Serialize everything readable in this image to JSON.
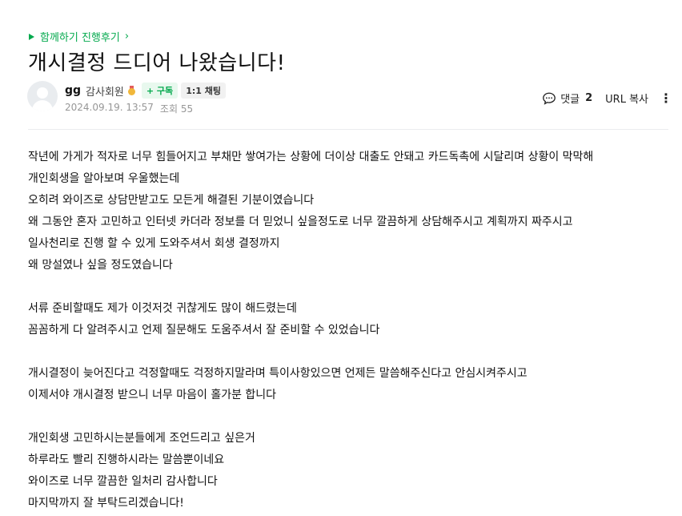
{
  "board": {
    "name": "함께하기 진행후기",
    "chevron": "›"
  },
  "post": {
    "title": "개시결정 드디어 나왔습니다!",
    "author": {
      "nickname": "gg",
      "grade": "감사회원",
      "subscribe_label": "+ 구독",
      "chat_label": "1:1 채팅"
    },
    "date": "2024.09.19. 13:57",
    "views": "조회 55"
  },
  "tools": {
    "comment_label": "댓글",
    "comment_count": "2",
    "url_copy_label": "URL 복사",
    "more_label": "⋮"
  },
  "body": {
    "lines": [
      "작년에 가게가 적자로 너무 힘들어지고 부채만 쌓여가는 상황에 더이상 대출도 안돼고 카드독촉에 시달리며 상황이 막막해",
      "개인회생을 알아보며 우울했는데",
      "오히려 와이즈로 상담만받고도 모든게 해결된 기분이였습니다",
      "왜 그동안 혼자 고민하고 인터넷 카더라 정보를 더 믿었니 싶을정도로 너무 깔끔하게 상담해주시고 계획까지 짜주시고",
      "일사천리로 진행 할 수 있게 도와주셔서 회생 결정까지",
      "왜 망설였나 싶을 정도였습니다",
      "",
      "서류 준비할때도 제가 이것저것 귀찮게도 많이 해드렸는데",
      "꼼꼼하게 다 알려주시고 언제 질문해도 도움주셔서 잘 준비할 수 있었습니다",
      "",
      "개시결정이 늦어진다고 걱정할때도 걱정하지말라며 특이사항있으면 언제든 말씀해주신다고 안심시켜주시고",
      "이제서야 개시결정 받으니 너무 마음이 홀가분 합니다",
      "",
      "개인회생 고민하시는분들에게 조언드리고 싶은거",
      "하루라도 빨리 진행하시라는 말씀뿐이네요",
      "와이즈로 너무 깔끔한 일처리 감사합니다",
      "마지막까지 잘 부탁드리겠습니다!"
    ]
  },
  "colors": {
    "accent": "#03a94d",
    "meta": "#979797",
    "divider": "#ebecef"
  },
  "icons": [
    "flag-icon",
    "chevron-right-icon",
    "default-avatar-icon",
    "medal-icon",
    "comment-bubble-icon",
    "more-vertical-icon"
  ]
}
